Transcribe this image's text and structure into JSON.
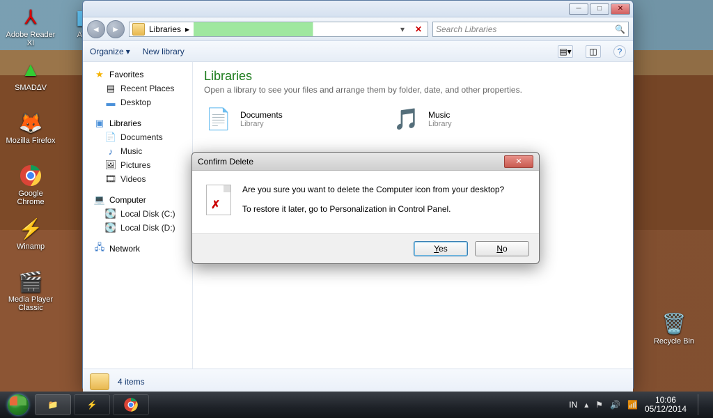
{
  "desktop": {
    "icons": [
      {
        "label": "Adobe Reader XI",
        "glyph": "📕"
      },
      {
        "label": "AVG",
        "glyph": "◧"
      },
      {
        "label": "SMAD∆V",
        "glyph": "🔺"
      },
      {
        "label": "Mozilla Firefox",
        "glyph": "🦊"
      },
      {
        "label": "Google Chrome",
        "glyph": "⭕"
      },
      {
        "label": "Winamp",
        "glyph": "⚡"
      },
      {
        "label": "Media Player Classic",
        "glyph": "🎬"
      }
    ],
    "recycle_label": "Recycle Bin"
  },
  "explorer": {
    "breadcrumb_root": "Libraries",
    "search_placeholder": "Search Libraries",
    "organize": "Organize",
    "newlibrary": "New library",
    "favorites": "Favorites",
    "fav_items": [
      "Recent Places",
      "Desktop"
    ],
    "libraries": "Libraries",
    "lib_items": [
      "Documents",
      "Music",
      "Pictures",
      "Videos"
    ],
    "computer": "Computer",
    "drives": [
      "Local Disk (C:)",
      "Local Disk (D:)"
    ],
    "network": "Network",
    "content_title": "Libraries",
    "content_sub": "Open a library to see your files and arrange them by folder, date, and other properties.",
    "libraries_main": [
      {
        "name": "Documents",
        "sub": "Library",
        "icon": "📄"
      },
      {
        "name": "Music",
        "sub": "Library",
        "icon": "🎵"
      }
    ],
    "status": "4 items"
  },
  "dialog": {
    "title": "Confirm Delete",
    "line1": "Are you sure you want to delete the Computer icon from your desktop?",
    "line2": "To restore it later, go to Personalization in Control Panel.",
    "yes": "Yes",
    "no": "No"
  },
  "taskbar": {
    "lang": "IN",
    "time": "10:06",
    "date": "05/12/2014"
  }
}
